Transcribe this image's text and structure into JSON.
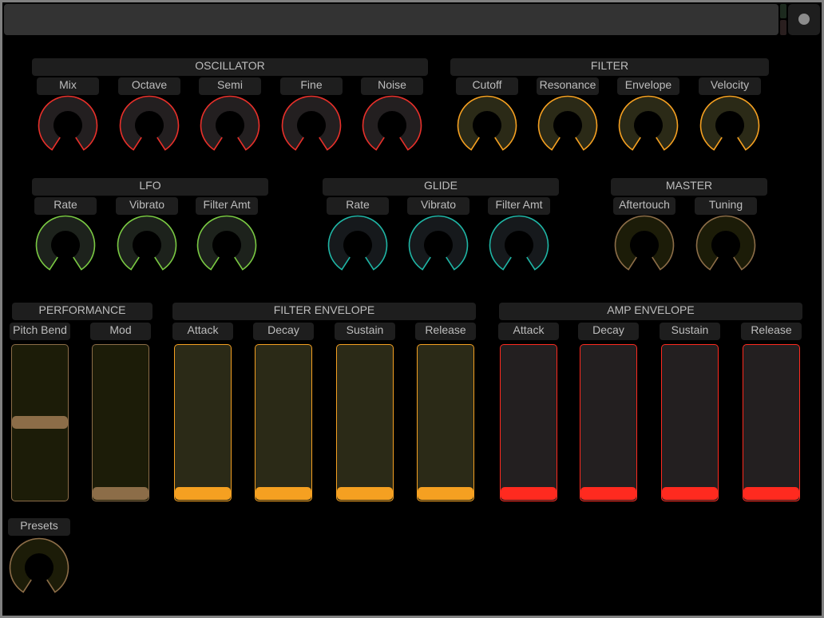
{
  "colors": {
    "osc": {
      "stroke": "#e8302a",
      "fill": "#231f20"
    },
    "filter": {
      "stroke": "#f5a021",
      "fill": "#2b2a17"
    },
    "lfo": {
      "stroke": "#7ac943",
      "fill": "#1d221c"
    },
    "glide": {
      "stroke": "#1fb5a5",
      "fill": "#16191c"
    },
    "master": {
      "stroke": "#8c6d48",
      "fill": "#1c1c08"
    }
  },
  "sections": {
    "oscillator": {
      "title": "OSCILLATOR",
      "knobs": [
        "Mix",
        "Octave",
        "Semi",
        "Fine",
        "Noise"
      ]
    },
    "filter": {
      "title": "FILTER",
      "knobs": [
        "Cutoff",
        "Resonance",
        "Envelope",
        "Velocity"
      ]
    },
    "lfo": {
      "title": "LFO",
      "knobs": [
        "Rate",
        "Vibrato",
        "Filter Amt"
      ]
    },
    "glide": {
      "title": "GLIDE",
      "knobs": [
        "Rate",
        "Vibrato",
        "Filter Amt"
      ]
    },
    "master": {
      "title": "MASTER",
      "knobs": [
        "Aftertouch",
        "Tuning"
      ]
    },
    "performance": {
      "title": "PERFORMANCE",
      "sliders": [
        {
          "label": "Pitch Bend",
          "value": 0.5
        },
        {
          "label": "Mod",
          "value": 0.0
        }
      ]
    },
    "filter_envelope": {
      "title": "FILTER ENVELOPE",
      "sliders": [
        {
          "label": "Attack",
          "value": 0.0
        },
        {
          "label": "Decay",
          "value": 0.0
        },
        {
          "label": "Sustain",
          "value": 0.0
        },
        {
          "label": "Release",
          "value": 0.0
        }
      ]
    },
    "amp_envelope": {
      "title": "AMP ENVELOPE",
      "sliders": [
        {
          "label": "Attack",
          "value": 0.0
        },
        {
          "label": "Decay",
          "value": 0.0
        },
        {
          "label": "Sustain",
          "value": 0.0
        },
        {
          "label": "Release",
          "value": 0.0
        }
      ]
    },
    "presets": {
      "label": "Presets"
    }
  },
  "slider_colors": {
    "performance": {
      "border": "#8c6d48",
      "fill": "#1c1c08",
      "thumb": "#8c6d48"
    },
    "filter_envelope": {
      "border": "#f5a021",
      "fill": "#2b2a17",
      "thumb": "#f5a021"
    },
    "amp_envelope": {
      "border": "#ff2a1f",
      "fill": "#231f20",
      "thumb": "#ff2a1f"
    }
  }
}
